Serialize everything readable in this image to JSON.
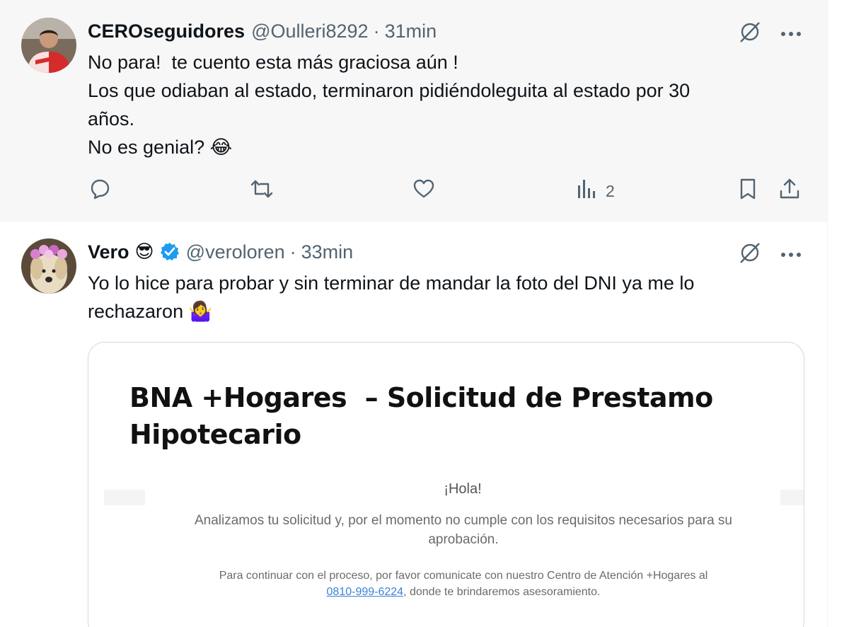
{
  "tweets": [
    {
      "name": "CEROseguidores",
      "handle": "@Oulleri8292",
      "separator": "·",
      "time": "31min",
      "lines": [
        "No para!  te cuento esta más graciosa aún !",
        "Los que odiaban al estado, terminaron pidiéndoleguita al estado por 30",
        "años.",
        "No es genial? 😂"
      ],
      "views": "2",
      "icons": [
        "grok-icon",
        "more-icon",
        "reply-icon",
        "retweet-icon",
        "like-icon",
        "views-icon",
        "bookmark-icon",
        "share-icon"
      ]
    },
    {
      "name": "Vero",
      "name_emoji": "😎",
      "handle": "@veroloren",
      "separator": "·",
      "time": "33min",
      "lines": [
        "Yo lo hice para probar y sin terminar de mandar la foto del DNI ya me lo",
        "rechazaron 🤷‍♀️"
      ],
      "card": {
        "title_line1": "BNA +Hogares  – Solicitud de Prestamo",
        "title_line2": "Hipotecario",
        "hola": "¡Hola!",
        "main_line1": "Analizamos tu solicitud y, por el momento no cumple con los requisitos necesarios para su",
        "main_line2": "aprobación.",
        "sub_line1": "Para continuar con el proceso, por favor comunicate con nuestro Centro de Atención +Hogares al",
        "phone": "0810-999-6224",
        "sub_line2_rest": ", donde te brindaremos asesoramiento."
      }
    }
  ],
  "colors": {
    "text": "#0f1419",
    "muted": "#536471",
    "verified": "#1d9bf0",
    "link": "#3b82d6"
  }
}
